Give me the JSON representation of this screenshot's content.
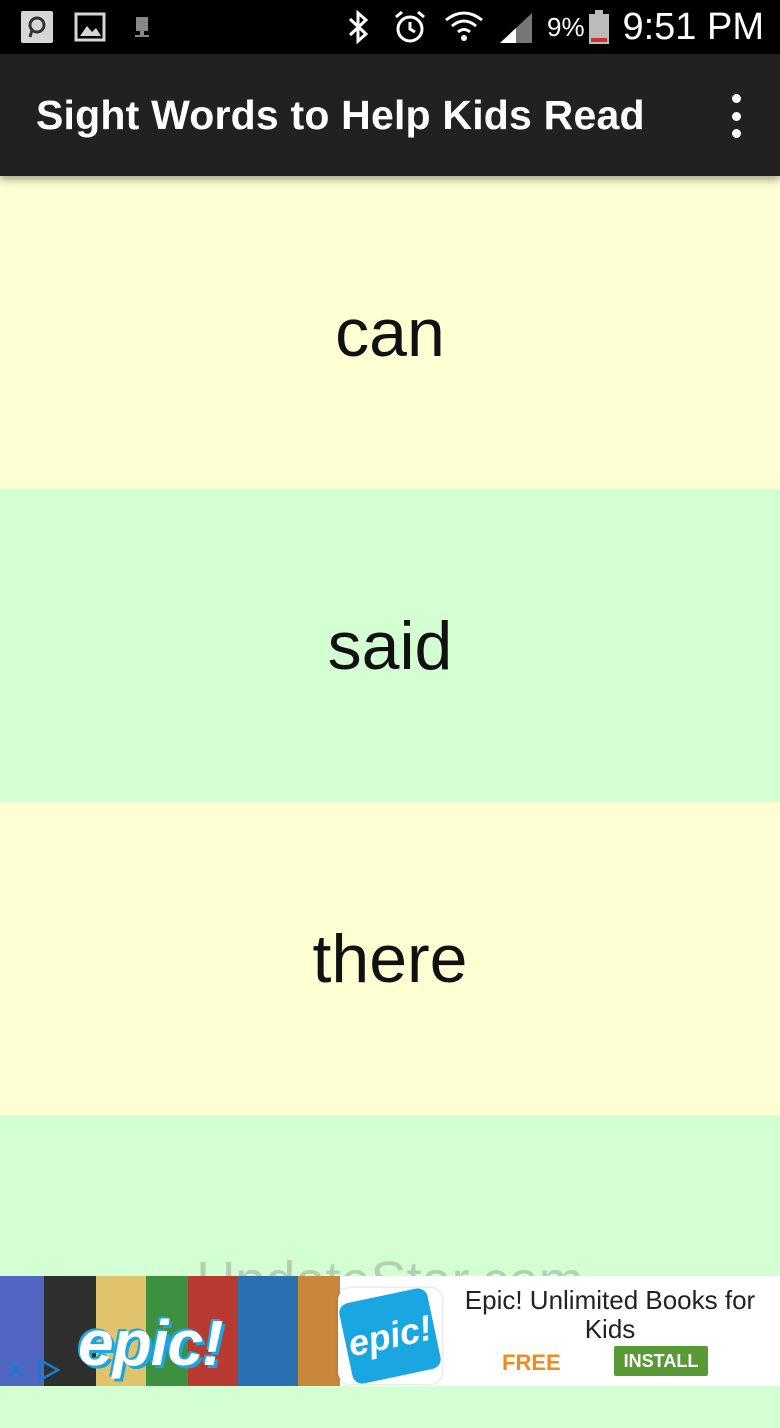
{
  "status_bar": {
    "time": "9:51 PM",
    "battery_percent": "9%",
    "icons": [
      "app-icon",
      "gallery-icon",
      "download-icon",
      "bluetooth-icon",
      "alarm-icon",
      "wifi-icon",
      "signal-icon",
      "battery-icon"
    ]
  },
  "app_bar": {
    "title": "Sight Words to Help Kids Read",
    "overflow_icon": "more-vert-icon"
  },
  "words": [
    {
      "text": "can",
      "color": "#ffffd4"
    },
    {
      "text": "said",
      "color": "#d3ffd3"
    },
    {
      "text": "there",
      "color": "#ffffd4"
    },
    {
      "text": "",
      "color": "#d3ffd3"
    }
  ],
  "watermark": "UpdateStar.com",
  "ad": {
    "collage_logo": "epic!",
    "app_icon_label": "epic!",
    "headline": "Epic! Unlimited Books for Kids",
    "price": "FREE",
    "install_label": "INSTALL",
    "accent_orange": "#f08c1a",
    "install_green": "#5a9a36"
  }
}
